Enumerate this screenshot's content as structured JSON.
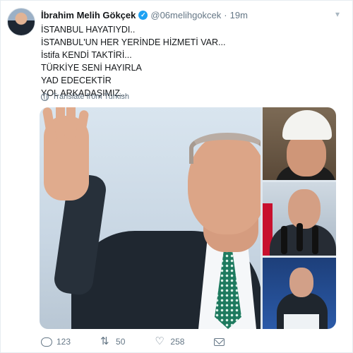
{
  "tweet": {
    "author_name": "İbrahim Melih Gökçek",
    "verified_mark": "✓",
    "handle": "@06melihgokcek",
    "separator": "·",
    "time": "19m",
    "caret_icon": "▾",
    "lines": [
      "İSTANBUL HAYATIYDI..",
      "İSTANBUL'UN HER YERİNDE HİZMETİ VAR...",
      "İstifa KENDİ TAKTİRİ...",
      "TÜRKİYE SENİ HAYIRLA",
      "YAD EDECEKTİR",
      "YOL ARKADAŞIMIZ..."
    ],
    "translate_label": "Translate from Turkish"
  },
  "actions": {
    "reply_count": "123",
    "retweet_count": "50",
    "like_count": "258",
    "retweet_glyph": "⇅",
    "like_glyph": "♡"
  },
  "colors": {
    "accent": "#1da1f2",
    "text": "#14171a",
    "muted": "#657786",
    "tie": "#1e7a5f"
  },
  "icons": [
    "avatar",
    "verified-badge-icon",
    "caret-down-icon",
    "globe-icon",
    "reply-icon",
    "retweet-icon",
    "like-icon",
    "direct-message-icon"
  ]
}
